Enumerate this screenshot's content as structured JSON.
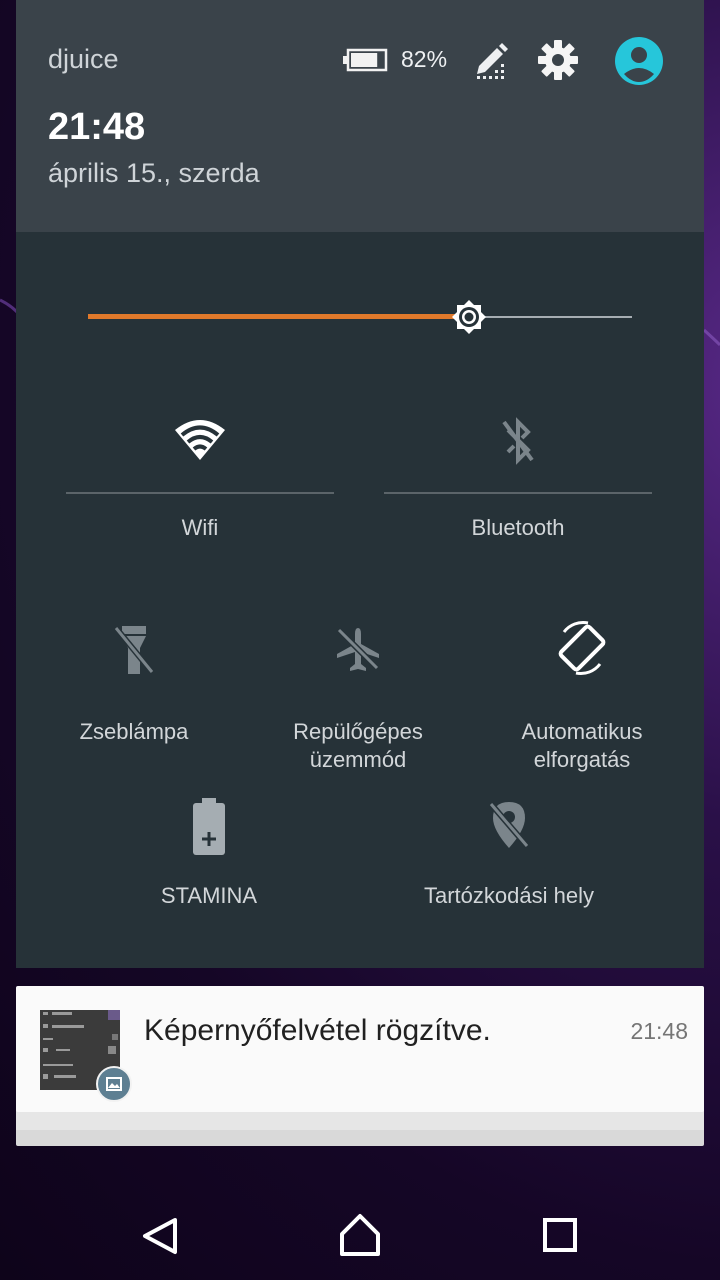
{
  "header": {
    "carrier": "djuice",
    "battery_percent": "82%",
    "battery_level": 0.82,
    "time": "21:48",
    "date": "április 15., szerda",
    "avatar_color": "#26c6da"
  },
  "quick_settings": {
    "brightness_level": 0.7,
    "brightness_color": "#e0792b",
    "tiles": [
      {
        "label": "Wifi",
        "icon": "wifi-icon",
        "active": true
      },
      {
        "label": "Bluetooth",
        "icon": "bluetooth-off-icon",
        "active": false
      },
      {
        "label": "Zseblámpa",
        "icon": "flashlight-off-icon",
        "active": false
      },
      {
        "label": "Repülőgépes üzemmód",
        "icon": "airplane-off-icon",
        "active": false
      },
      {
        "label": "Automatikus elforgatás",
        "icon": "auto-rotate-icon",
        "active": true
      },
      {
        "label": "STAMINA",
        "icon": "stamina-battery-icon",
        "active": false
      },
      {
        "label": "Tartózkodási hely",
        "icon": "location-off-icon",
        "active": false
      }
    ]
  },
  "notification": {
    "title": "Képernyőfelvétel rögzítve.",
    "time": "21:48",
    "thumb_lines": [
      "",
      "Legfelkeltebb",
      "",
      "",
      "",
      "Play Áruház"
    ]
  },
  "navbar": {
    "back": "back-icon",
    "home": "home-icon",
    "recents": "recents-icon"
  }
}
